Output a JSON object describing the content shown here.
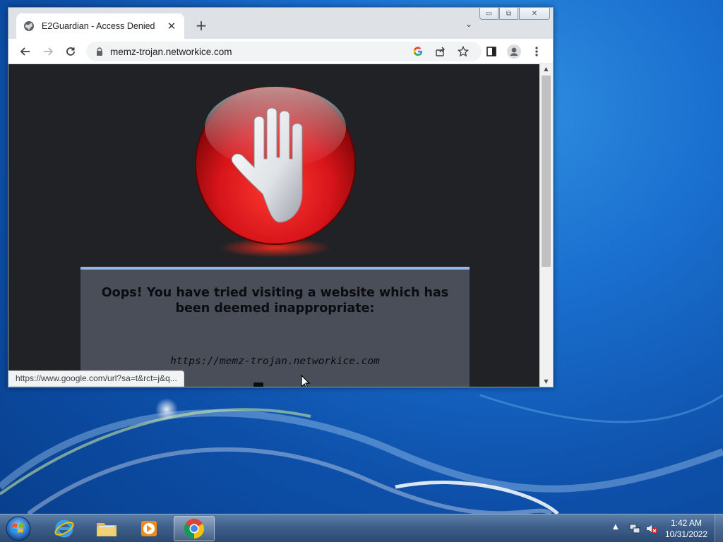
{
  "browser": {
    "tab": {
      "title": "E2Guardian - Access Denied",
      "close": "✕"
    },
    "new_tab": "+",
    "tab_list": "⌄",
    "caption": {
      "minimize": "▭",
      "maximize": "⧉",
      "close": "✕"
    },
    "url": "memz-trojan.networkice.com",
    "status_url": "https://www.google.com/url?sa=t&rct=j&q..."
  },
  "page": {
    "message": "Oops! You have tried visiting a website which has been deemed inappropriate:",
    "blocked_url": "https://memz-trojan.networkice.com"
  },
  "taskbar": {
    "time": "1:42 AM",
    "date": "10/31/2022",
    "apps": [
      "start-orb",
      "internet-explorer",
      "windows-explorer",
      "media-player",
      "chrome"
    ]
  },
  "colors": {
    "page_bg": "#202226",
    "panel_bg": "#4a4e58",
    "panel_border": "#8fb8e8",
    "stop_red": "#d6141a"
  }
}
